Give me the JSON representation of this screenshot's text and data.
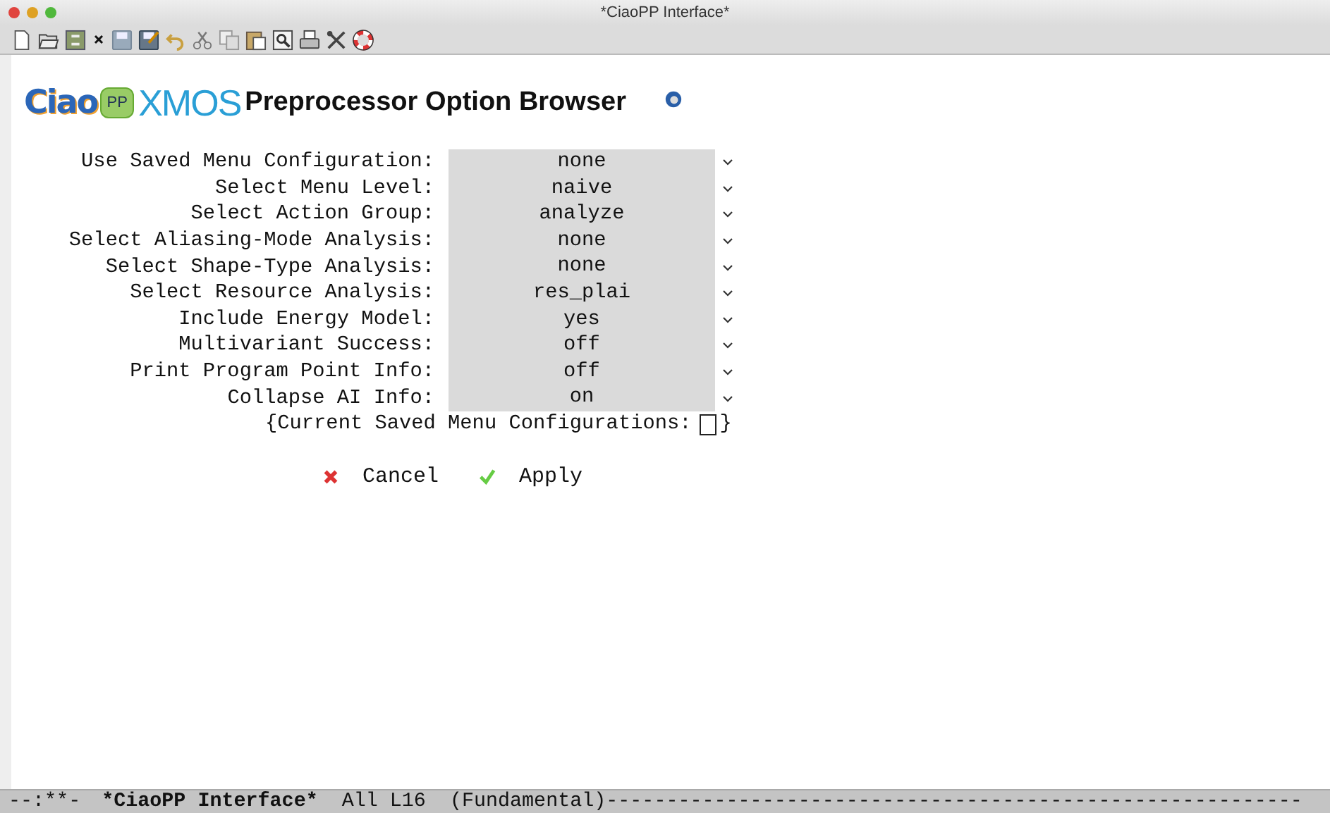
{
  "window": {
    "title": "*CiaoPP Interface*"
  },
  "logo": {
    "ciao": "Ciao",
    "pp": "PP",
    "xmos": "XMOS"
  },
  "heading": "Preprocessor Option Browser",
  "options": [
    {
      "label": "Use Saved Menu Configuration:",
      "value": "none"
    },
    {
      "label": "Select Menu Level:",
      "value": "naive"
    },
    {
      "label": "Select Action Group:",
      "value": "analyze"
    },
    {
      "label": "Select Aliasing-Mode Analysis:",
      "value": "none"
    },
    {
      "label": "Select Shape-Type Analysis:",
      "value": "none"
    },
    {
      "label": "Select Resource Analysis:",
      "value": "res_plai"
    },
    {
      "label": "Include Energy Model:",
      "value": "yes"
    },
    {
      "label": "Multivariant Success:",
      "value": "off"
    },
    {
      "label": "Print Program Point Info:",
      "value": "off"
    },
    {
      "label": "Collapse AI Info:",
      "value": "on"
    }
  ],
  "saved_configs": {
    "open": "{Current Saved Menu Configurations:",
    "close": "}"
  },
  "buttons": [
    {
      "label": "Cancel",
      "kind": "cancel"
    },
    {
      "label": "Apply",
      "kind": "apply"
    }
  ],
  "status_bar": {
    "flags": "--:**-",
    "buffer": "*CiaoPP Interface*",
    "position": "All L16",
    "mode": "(Fundamental)----------------------------------------------------------"
  }
}
